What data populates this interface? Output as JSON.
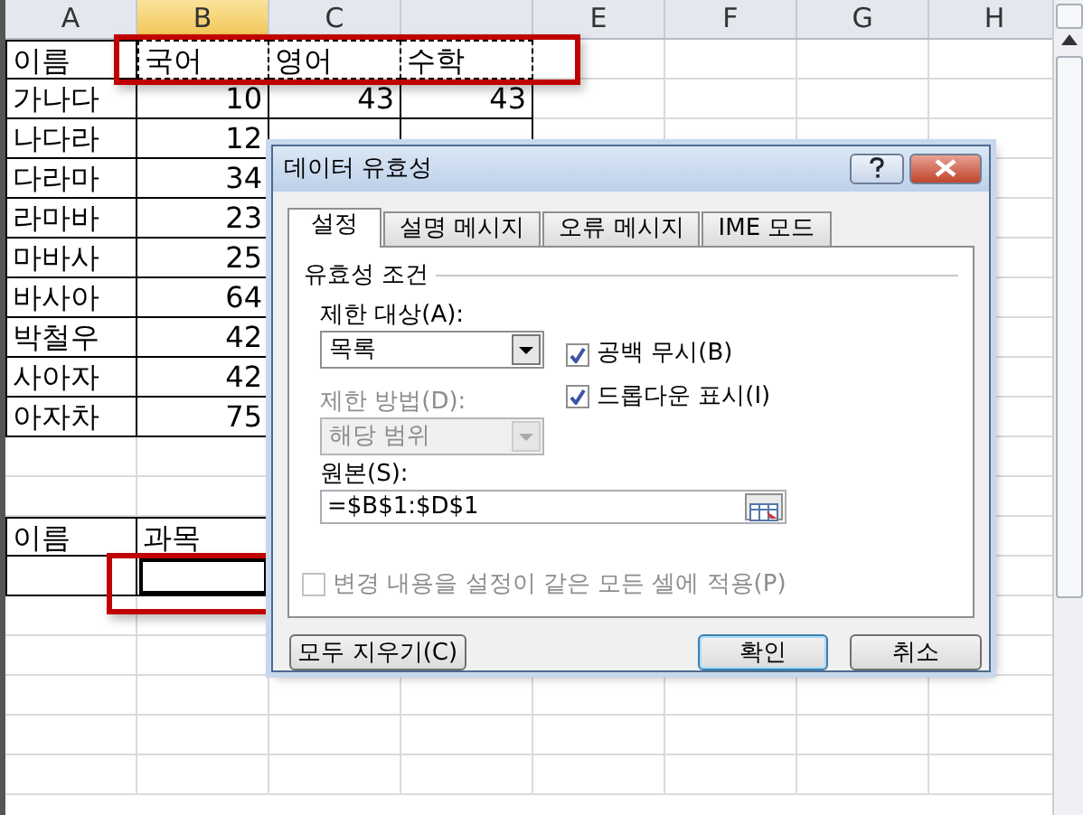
{
  "sheet": {
    "columns": [
      {
        "label": "A",
        "selected": false
      },
      {
        "label": "B",
        "selected": true
      },
      {
        "label": "C",
        "selected": false
      },
      {
        "selected": false
      },
      {
        "label": "E",
        "selected": false
      },
      {
        "label": "F",
        "selected": false
      },
      {
        "label": "G",
        "selected": false
      },
      {
        "label": "H",
        "selected": false
      }
    ],
    "table": [
      [
        {
          "kind": "text",
          "text": "이름"
        },
        {
          "kind": "text",
          "text": "국어",
          "marquee": true
        },
        {
          "kind": "text",
          "text": "영어",
          "marquee": true
        },
        {
          "kind": "text",
          "text": "수학",
          "marquee": true
        }
      ],
      [
        {
          "kind": "text",
          "text": "가나다"
        },
        {
          "kind": "number",
          "text": "10"
        },
        {
          "kind": "number",
          "text": "43"
        },
        {
          "kind": "number",
          "text": "43"
        }
      ],
      [
        {
          "kind": "text",
          "text": "나다라"
        },
        {
          "kind": "number",
          "text": "12"
        }
      ],
      [
        {
          "kind": "text",
          "text": "다라마"
        },
        {
          "kind": "number",
          "text": "34"
        }
      ],
      [
        {
          "kind": "text",
          "text": "라마바"
        },
        {
          "kind": "number",
          "text": "23"
        }
      ],
      [
        {
          "kind": "text",
          "text": "마바사"
        },
        {
          "kind": "number",
          "text": "25"
        }
      ],
      [
        {
          "kind": "text",
          "text": "바사아"
        },
        {
          "kind": "number",
          "text": "64"
        }
      ],
      [
        {
          "kind": "text",
          "text": "박철우"
        },
        {
          "kind": "number",
          "text": "42"
        }
      ],
      [
        {
          "kind": "text",
          "text": "사아자"
        },
        {
          "kind": "number",
          "text": "42"
        }
      ],
      [
        {
          "kind": "text",
          "text": "아자차"
        },
        {
          "kind": "number",
          "text": "75"
        }
      ]
    ],
    "lookup": [
      [
        {
          "kind": "text",
          "text": "이름"
        },
        {
          "kind": "text",
          "text": "과목"
        }
      ],
      [
        {
          "selected": false
        },
        {
          "selected": true
        }
      ]
    ]
  },
  "dialog": {
    "title": "데이터 유효성",
    "tabs": [
      {
        "label": "설정",
        "selected": true
      },
      {
        "label": "설명 메시지",
        "selected": false
      },
      {
        "label": "오류 메시지",
        "selected": false
      },
      {
        "label": "IME 모드",
        "selected": false
      }
    ],
    "group": "유효성 조건",
    "allow": {
      "label": "제한 대상(A):",
      "value": "목록",
      "disabled": false
    },
    "data": {
      "label": "제한 방법(D):",
      "value": "해당 범위",
      "disabled": true
    },
    "checkboxes": [
      {
        "label": "공백 무시(B)",
        "checked": true,
        "disabled": false
      },
      {
        "label": "드롭다운 표시(I)",
        "checked": true,
        "disabled": false
      }
    ],
    "source": {
      "label": "원본(S):",
      "value": "=$B$1:$D$1"
    },
    "apply_all": {
      "label": "변경 내용을 설정이 같은 모든 셀에 적용(P)",
      "checked": false,
      "disabled": true
    },
    "buttons": [
      {
        "label": "모두 지우기(C)",
        "default": false
      },
      {
        "label": "확인",
        "default": true
      },
      {
        "label": "취소",
        "default": false
      }
    ]
  }
}
